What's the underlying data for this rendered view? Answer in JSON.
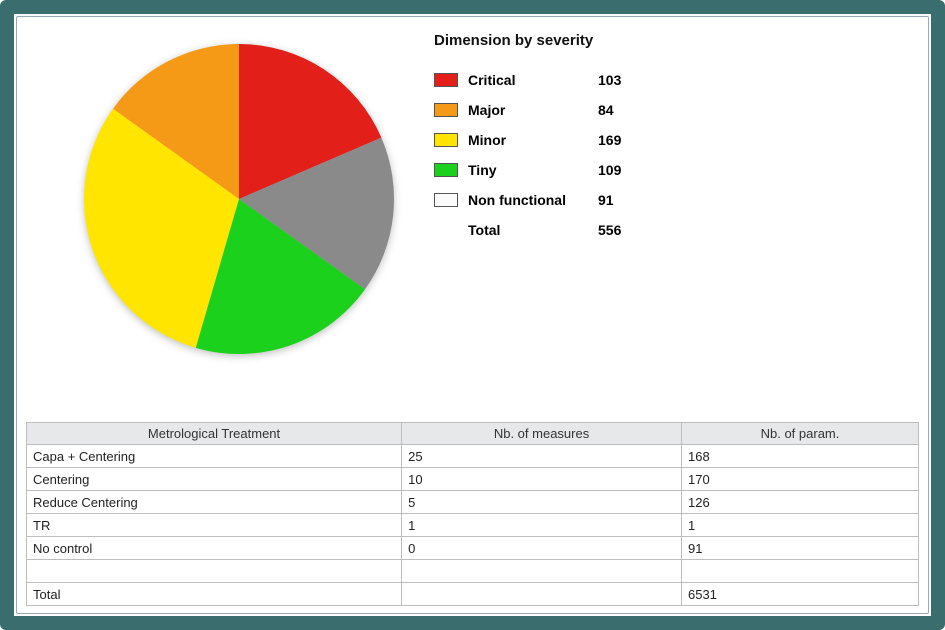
{
  "chart_data": {
    "type": "pie",
    "title": "Dimension by severity",
    "total_label": "Total",
    "total_value": 556,
    "series": [
      {
        "name": "Critical",
        "value": 103,
        "color": "#e21f18"
      },
      {
        "name": "Major",
        "value": 84,
        "color": "#f59a17"
      },
      {
        "name": "Minor",
        "value": 169,
        "color": "#ffe500"
      },
      {
        "name": "Tiny",
        "value": 109,
        "color": "#1bd11b"
      },
      {
        "name": "Non functional",
        "value": 91,
        "color": "#fbfbfb"
      }
    ],
    "non_functional_display_color": "#8a8a8a"
  },
  "table": {
    "headers": [
      "Metrological Treatment",
      "Nb. of measures",
      "Nb. of param."
    ],
    "rows": [
      [
        "Capa + Centering",
        "25",
        "168"
      ],
      [
        "Centering",
        "10",
        "170"
      ],
      [
        "Reduce Centering",
        "5",
        "126"
      ],
      [
        "TR",
        "1",
        "1"
      ],
      [
        "No control",
        "0",
        "91"
      ],
      [
        "",
        "",
        ""
      ],
      [
        "Total",
        "",
        "6531"
      ]
    ]
  }
}
